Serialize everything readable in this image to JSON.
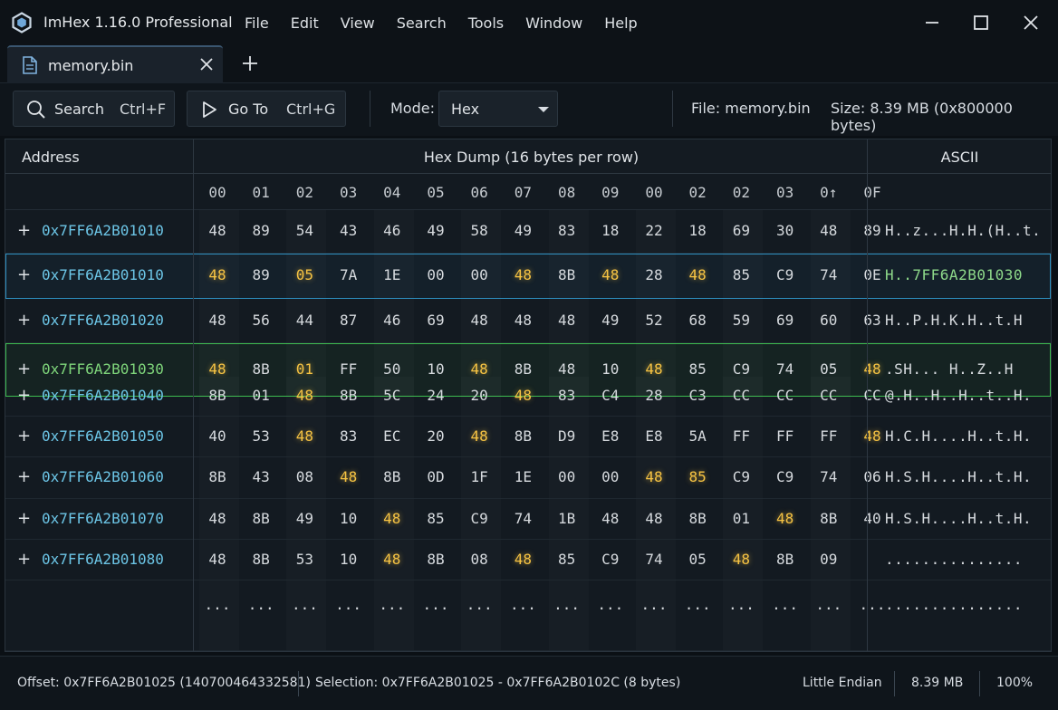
{
  "app": {
    "title": "ImHex 1.16.0 Professional",
    "menu": [
      "File",
      "Edit",
      "View",
      "Search",
      "Tools",
      "Window",
      "Help"
    ]
  },
  "tab": {
    "label": "memory.bin"
  },
  "toolbar": {
    "search_label": "Search",
    "search_shortcut": "Ctrl+F",
    "goto_label": "Go To",
    "goto_shortcut": "Ctrl+G",
    "mode_label": "Mode:",
    "mode_value": "Hex",
    "file_info": "File: memory.bin",
    "size_info": "Size: 8.39 MB (0x800000 bytes)"
  },
  "grid": {
    "headers": {
      "address": "Address",
      "hex": "Hex Dump (16 bytes per row)",
      "ascii": "ASCII"
    },
    "offsets": [
      "00",
      "01",
      "02",
      "03",
      "04",
      "05",
      "06",
      "07",
      "08",
      "09",
      "00",
      "02",
      "02",
      "03",
      "0↑",
      "0F"
    ],
    "rows": [
      {
        "address": "0x7FF6A2B01010",
        "bytes": [
          "48",
          "89",
          "54",
          "43",
          "46",
          "49",
          "58",
          "49",
          "83",
          "18",
          "22",
          "18",
          "69",
          "30",
          "48",
          "89"
        ],
        "highlighted": [],
        "ascii": "H..z...H.H.(H..t.",
        "style": "normal"
      },
      {
        "address": "0x7FF6A2B01010",
        "bytes": [
          "48",
          "89",
          "05",
          "7A",
          "1E",
          "00",
          "00",
          "48",
          "8B",
          "48",
          "28",
          "48",
          "85",
          "C9",
          "74",
          "0E"
        ],
        "highlighted": [
          0,
          2,
          7,
          9,
          11
        ],
        "ascii": "H..7FF6A2B01030",
        "style": "blue"
      },
      {
        "address": "0x7FF6A2B01020",
        "bytes": [
          "48",
          "56",
          "44",
          "87",
          "46",
          "69",
          "48",
          "48",
          "48",
          "49",
          "52",
          "68",
          "59",
          "69",
          "60",
          "63"
        ],
        "highlighted": [],
        "ascii": "H..P.H.K.H..t.H",
        "style": "normal"
      },
      {
        "address": "0x7FF6A2B01030",
        "bytes": [
          "48",
          "8B",
          "01",
          "FF",
          "50",
          "10",
          "48",
          "8B",
          "48",
          "10",
          "48",
          "85",
          "C9",
          "74",
          "05",
          "48"
        ],
        "highlighted": [
          0,
          2,
          6,
          10,
          15
        ],
        "ascii": ".SH... H..Z..H",
        "style": "green"
      },
      {
        "address": "0x7FF6A2B01040",
        "bytes": [
          "8B",
          "01",
          "48",
          "8B",
          "5C",
          "24",
          "20",
          "48",
          "83",
          "C4",
          "28",
          "C3",
          "CC",
          "CC",
          "CC",
          "CC"
        ],
        "highlighted": [
          2,
          7
        ],
        "ascii": "@.H..H..H..t..H.",
        "style": "normal"
      },
      {
        "address": "0x7FF6A2B01050",
        "bytes": [
          "40",
          "53",
          "48",
          "83",
          "EC",
          "20",
          "48",
          "8B",
          "D9",
          "E8",
          "E8",
          "5A",
          "FF",
          "FF",
          "FF",
          "48"
        ],
        "highlighted": [
          2,
          6,
          15
        ],
        "ascii": "H.C.H....H..t.H.",
        "style": "normal"
      },
      {
        "address": "0x7FF6A2B01060",
        "bytes": [
          "8B",
          "43",
          "08",
          "48",
          "8B",
          "0D",
          "1F",
          "1E",
          "00",
          "00",
          "48",
          "85",
          "C9",
          "C9",
          "74",
          "06"
        ],
        "highlighted": [
          3,
          10,
          11
        ],
        "ascii": "H.S.H....H..t.H.",
        "style": "normal"
      },
      {
        "address": "0x7FF6A2B01070",
        "bytes": [
          "48",
          "8B",
          "49",
          "10",
          "48",
          "85",
          "C9",
          "74",
          "1B",
          "48",
          "48",
          "8B",
          "01",
          "48",
          "8B",
          "40"
        ],
        "highlighted": [
          4,
          13
        ],
        "ascii": "H.S.H....H..t.H.",
        "style": "normal"
      },
      {
        "address": "0x7FF6A2B01080",
        "bytes": [
          "48",
          "8B",
          "53",
          "10",
          "48",
          "8B",
          "08",
          "48",
          "85",
          "C9",
          "74",
          "05",
          "48",
          "8B",
          "09",
          ""
        ],
        "highlighted": [
          4,
          7,
          12
        ],
        "ascii": "...............",
        "style": "normal"
      },
      {
        "address": "",
        "bytes": [
          "...",
          "...",
          "...",
          "...",
          "...",
          "...",
          "...",
          "...",
          "...",
          "...",
          "...",
          "...",
          "...",
          "...",
          "...",
          "..."
        ],
        "highlighted": [],
        "ascii": "...............",
        "style": "ellipsis"
      }
    ]
  },
  "status": {
    "offset": "Offset: 0x7FF6A2B01025 (140700464332581)",
    "selection": "Selection: 0x7FF6A2B01025 - 0x7FF6A2B0102C (8 bytes)",
    "endian": "Little Endian",
    "size": "8.39 MB",
    "zoom": "100%"
  },
  "colors": {
    "accent_blue": "#2d8fc0",
    "accent_green": "#3dbb4f",
    "highlight_yellow": "#f6c343",
    "address_cyan": "#6cc5e6"
  },
  "icons": [
    "app-logo-icon",
    "file-icon",
    "close-icon",
    "plus-icon",
    "search-icon",
    "play-icon",
    "chevron-down-icon",
    "minimize-icon",
    "maximize-icon"
  ]
}
